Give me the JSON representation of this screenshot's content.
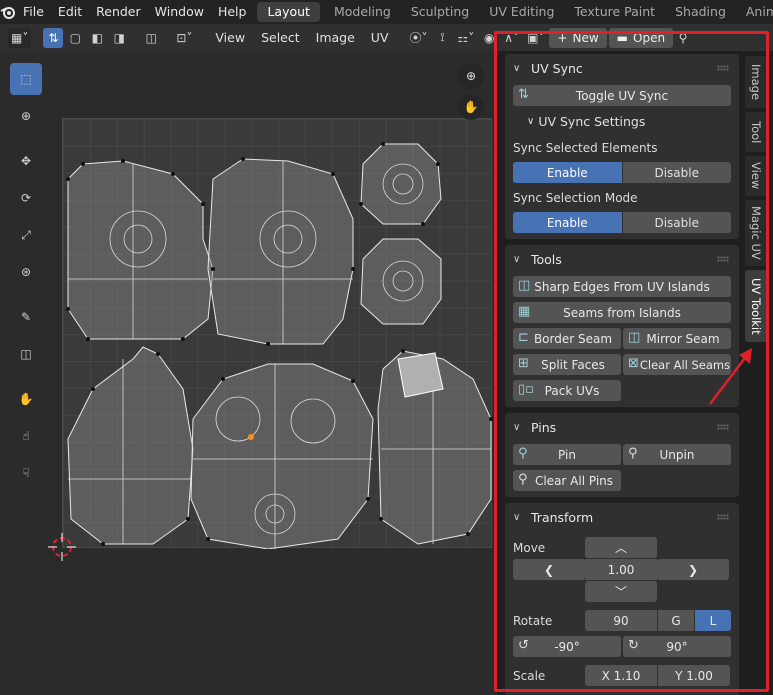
{
  "menubar": {
    "items": [
      "File",
      "Edit",
      "Render",
      "Window",
      "Help"
    ],
    "workspaces": [
      "Layout",
      "Modeling",
      "Sculpting",
      "UV Editing",
      "Texture Paint",
      "Shading",
      "Animation"
    ],
    "active_workspace": "Layout"
  },
  "header": {
    "menus": [
      "View",
      "Select",
      "Image",
      "UV"
    ],
    "new_label": "New",
    "open_label": "Open"
  },
  "tabs": [
    "Image",
    "Tool",
    "View",
    "Magic UV",
    "UV Toolkit"
  ],
  "active_tab": "UV Toolkit",
  "panels": {
    "uv_sync": {
      "title": "UV Sync",
      "toggle_label": "Toggle UV Sync",
      "settings_title": "UV Sync Settings",
      "sync_selected_label": "Sync Selected Elements",
      "sync_selection_mode_label": "Sync Selection Mode",
      "enable_label": "Enable",
      "disable_label": "Disable"
    },
    "tools": {
      "title": "Tools",
      "sharp_edges": "Sharp Edges From UV Islands",
      "seams_from_islands": "Seams from Islands",
      "border_seam": "Border Seam",
      "mirror_seam": "Mirror Seam",
      "split_faces": "Split Faces",
      "clear_all_seams": "Clear All Seams",
      "pack_uvs": "Pack UVs"
    },
    "pins": {
      "title": "Pins",
      "pin": "Pin",
      "unpin": "Unpin",
      "clear_all_pins": "Clear All Pins"
    },
    "transform": {
      "title": "Transform",
      "move_label": "Move",
      "move_value": "1.00",
      "rotate_label": "Rotate",
      "rotate_value": "90",
      "g_label": "G",
      "l_label": "L",
      "rot_neg": "-90°",
      "rot_pos": "90°",
      "scale_label": "Scale",
      "scale_x": "X 1.10",
      "scale_y": "Y 1.00"
    }
  },
  "colors": {
    "accent": "#4772b3",
    "highlight_frame": "#e0202a"
  }
}
